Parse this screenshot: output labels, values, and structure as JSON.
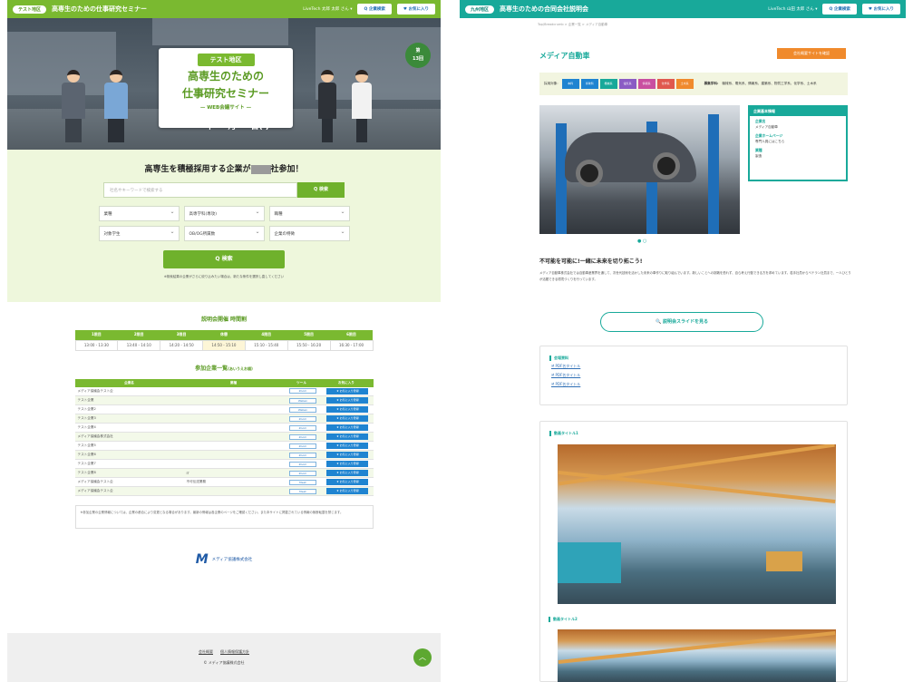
{
  "left": {
    "header": {
      "badge": "テスト地区",
      "title": "高専生のための仕事研究セミナー",
      "user": "LiveTech 太郎 太郎 さん ▾",
      "btn1": "Q 企業検索",
      "btn2": "♥ お気に入り"
    },
    "hero": {
      "tag": "テスト地区",
      "line1": "高専生のための",
      "line2": "仕事研究セミナー",
      "sub": "— WEB会議サイト —",
      "badge_line1": "第",
      "badge_line2": "13回",
      "date_year": "20",
      "date_y": "年",
      "date_m": "月",
      "date_d": "日( )"
    },
    "search": {
      "heading_pre": "高専生を積極採用する企業が",
      "heading_post": "社参加！",
      "placeholder": "社名やキーワードで検索する",
      "search_btn": "Q 検索",
      "selects": [
        "業種",
        "高専学科(専攻)",
        "職種",
        "対象学生",
        "OB/OG所属数",
        "企業の特徴"
      ],
      "submit": "Q 検索",
      "note": "※検索結果の企業がさらに絞り込みたい場合は、新たな条件を選択し直してください"
    },
    "schedule": {
      "title": "説明会開催 時間割",
      "headers": [
        "1限目",
        "2限目",
        "3限目",
        "休憩",
        "4限目",
        "5限目",
        "6限目"
      ],
      "times": [
        "13:00 - 13:30",
        "13:40 - 14:10",
        "14:20 - 14:50",
        "14:50 - 15:10",
        "15:10 - 15:40",
        "15:50 - 16:20",
        "16:30 - 17:00"
      ]
    },
    "companies": {
      "title": "参加企業一覧",
      "title_suffix": "(あいうえお順)",
      "headers": [
        "企業名",
        "業種",
        "ツール",
        "お気に入り"
      ],
      "rows": [
        [
          "メディア協議会テスト企",
          "",
          "Zoom"
        ],
        [
          "テスト企業",
          "",
          "Webex"
        ],
        [
          "テスト企業2",
          "",
          "Webex"
        ],
        [
          "テスト企業3",
          "",
          "Zoom"
        ],
        [
          "テスト企業4",
          "",
          "Zoom"
        ],
        [
          "メディア協議会株式会社",
          "",
          "Zoom"
        ],
        [
          "テスト企業5",
          "",
          "Zoom"
        ],
        [
          "テスト企業6",
          "",
          "Zoom"
        ],
        [
          "テスト企業7",
          "",
          "Zoom"
        ],
        [
          "テスト企業8",
          "IT",
          "Zoom"
        ],
        [
          "メディア協議会テスト企",
          "不可伝送業務",
          "Meet"
        ],
        [
          "メディア協議会テスト企",
          "",
          "Meet"
        ]
      ],
      "fav_label": "★ お気に入り登録"
    },
    "disclaimer": "※参加企業の企業情報については、企業の都合により変更となる場合があります。最新の情報は各企業のページをご確認ください。また本サイトに掲載されている情報の無断転載を禁じます。",
    "logo": {
      "mark": "M",
      "text": "メディア協議株式会社"
    },
    "footer": {
      "link1": "会社概要",
      "link2": "個人情報保護方針",
      "copy": "© メディア協議株式会社"
    },
    "colors": {
      "primary": "#7ab930",
      "button": "#6fb12c",
      "fav": "#1f84d1"
    }
  },
  "right": {
    "header": {
      "badge": "九州地区",
      "title": "高専生のための合同会社説明会",
      "user": "LiveTech 山田 太郎 さん ▾",
      "btn1": "Q 企業検索",
      "btn2": "♥ お気に入り"
    },
    "breadcrumb": "Top/Breadcrumb  >  企業一覧  >  メディア自動車",
    "company_name": "メディア自動車",
    "website_btn": "会社概要サイトを確認",
    "tags_label": "採用対象:",
    "tags": [
      {
        "label": "本科",
        "color": "#1f84d1"
      },
      {
        "label": "専攻科",
        "color": "#1f84d1"
      },
      {
        "label": "機械系",
        "color": "#18a99a"
      },
      {
        "label": "電気系",
        "color": "#8b5cc4"
      },
      {
        "label": "情報系",
        "color": "#c94fa0"
      },
      {
        "label": "化学系",
        "color": "#e0584e"
      },
      {
        "label": "土木系",
        "color": "#f08a2c"
      }
    ],
    "tags_label2": "募集学科:",
    "tags_text": "機械系、電気系、情報系、建築系、物質工学系、化学系、土木系",
    "info": {
      "header": "企業基本情報",
      "k1": "企業名",
      "v1": "メディア自動車",
      "k2": "企業ホームページ",
      "v2": "専門人員にはこちら",
      "k3": "業種",
      "v3": "製造"
    },
    "catch": "不可能を可能に!一緒に未来を切り拓こう!",
    "desc": "メディア自動車株式会社では自動車産業界を通して、次世代技術を活かした未来の車作りに取り組んでいます。新しいことへの挑戦を恐れず、自ら考え行動できる方を求めています。若手社員からベテラン社員まで、一人ひとりが活躍できる環境づくりを行っています。",
    "slide_btn": "説明会スライドを見る",
    "resources": {
      "title": "会場資料",
      "links": [
        "PDF名タイトル",
        "PDF名タイトル",
        "PDF名タイトル"
      ]
    },
    "video1": "動画タイトル1",
    "video2": "動画タイトル2",
    "colors": {
      "primary": "#18a99a",
      "accent": "#f08a2c"
    }
  }
}
